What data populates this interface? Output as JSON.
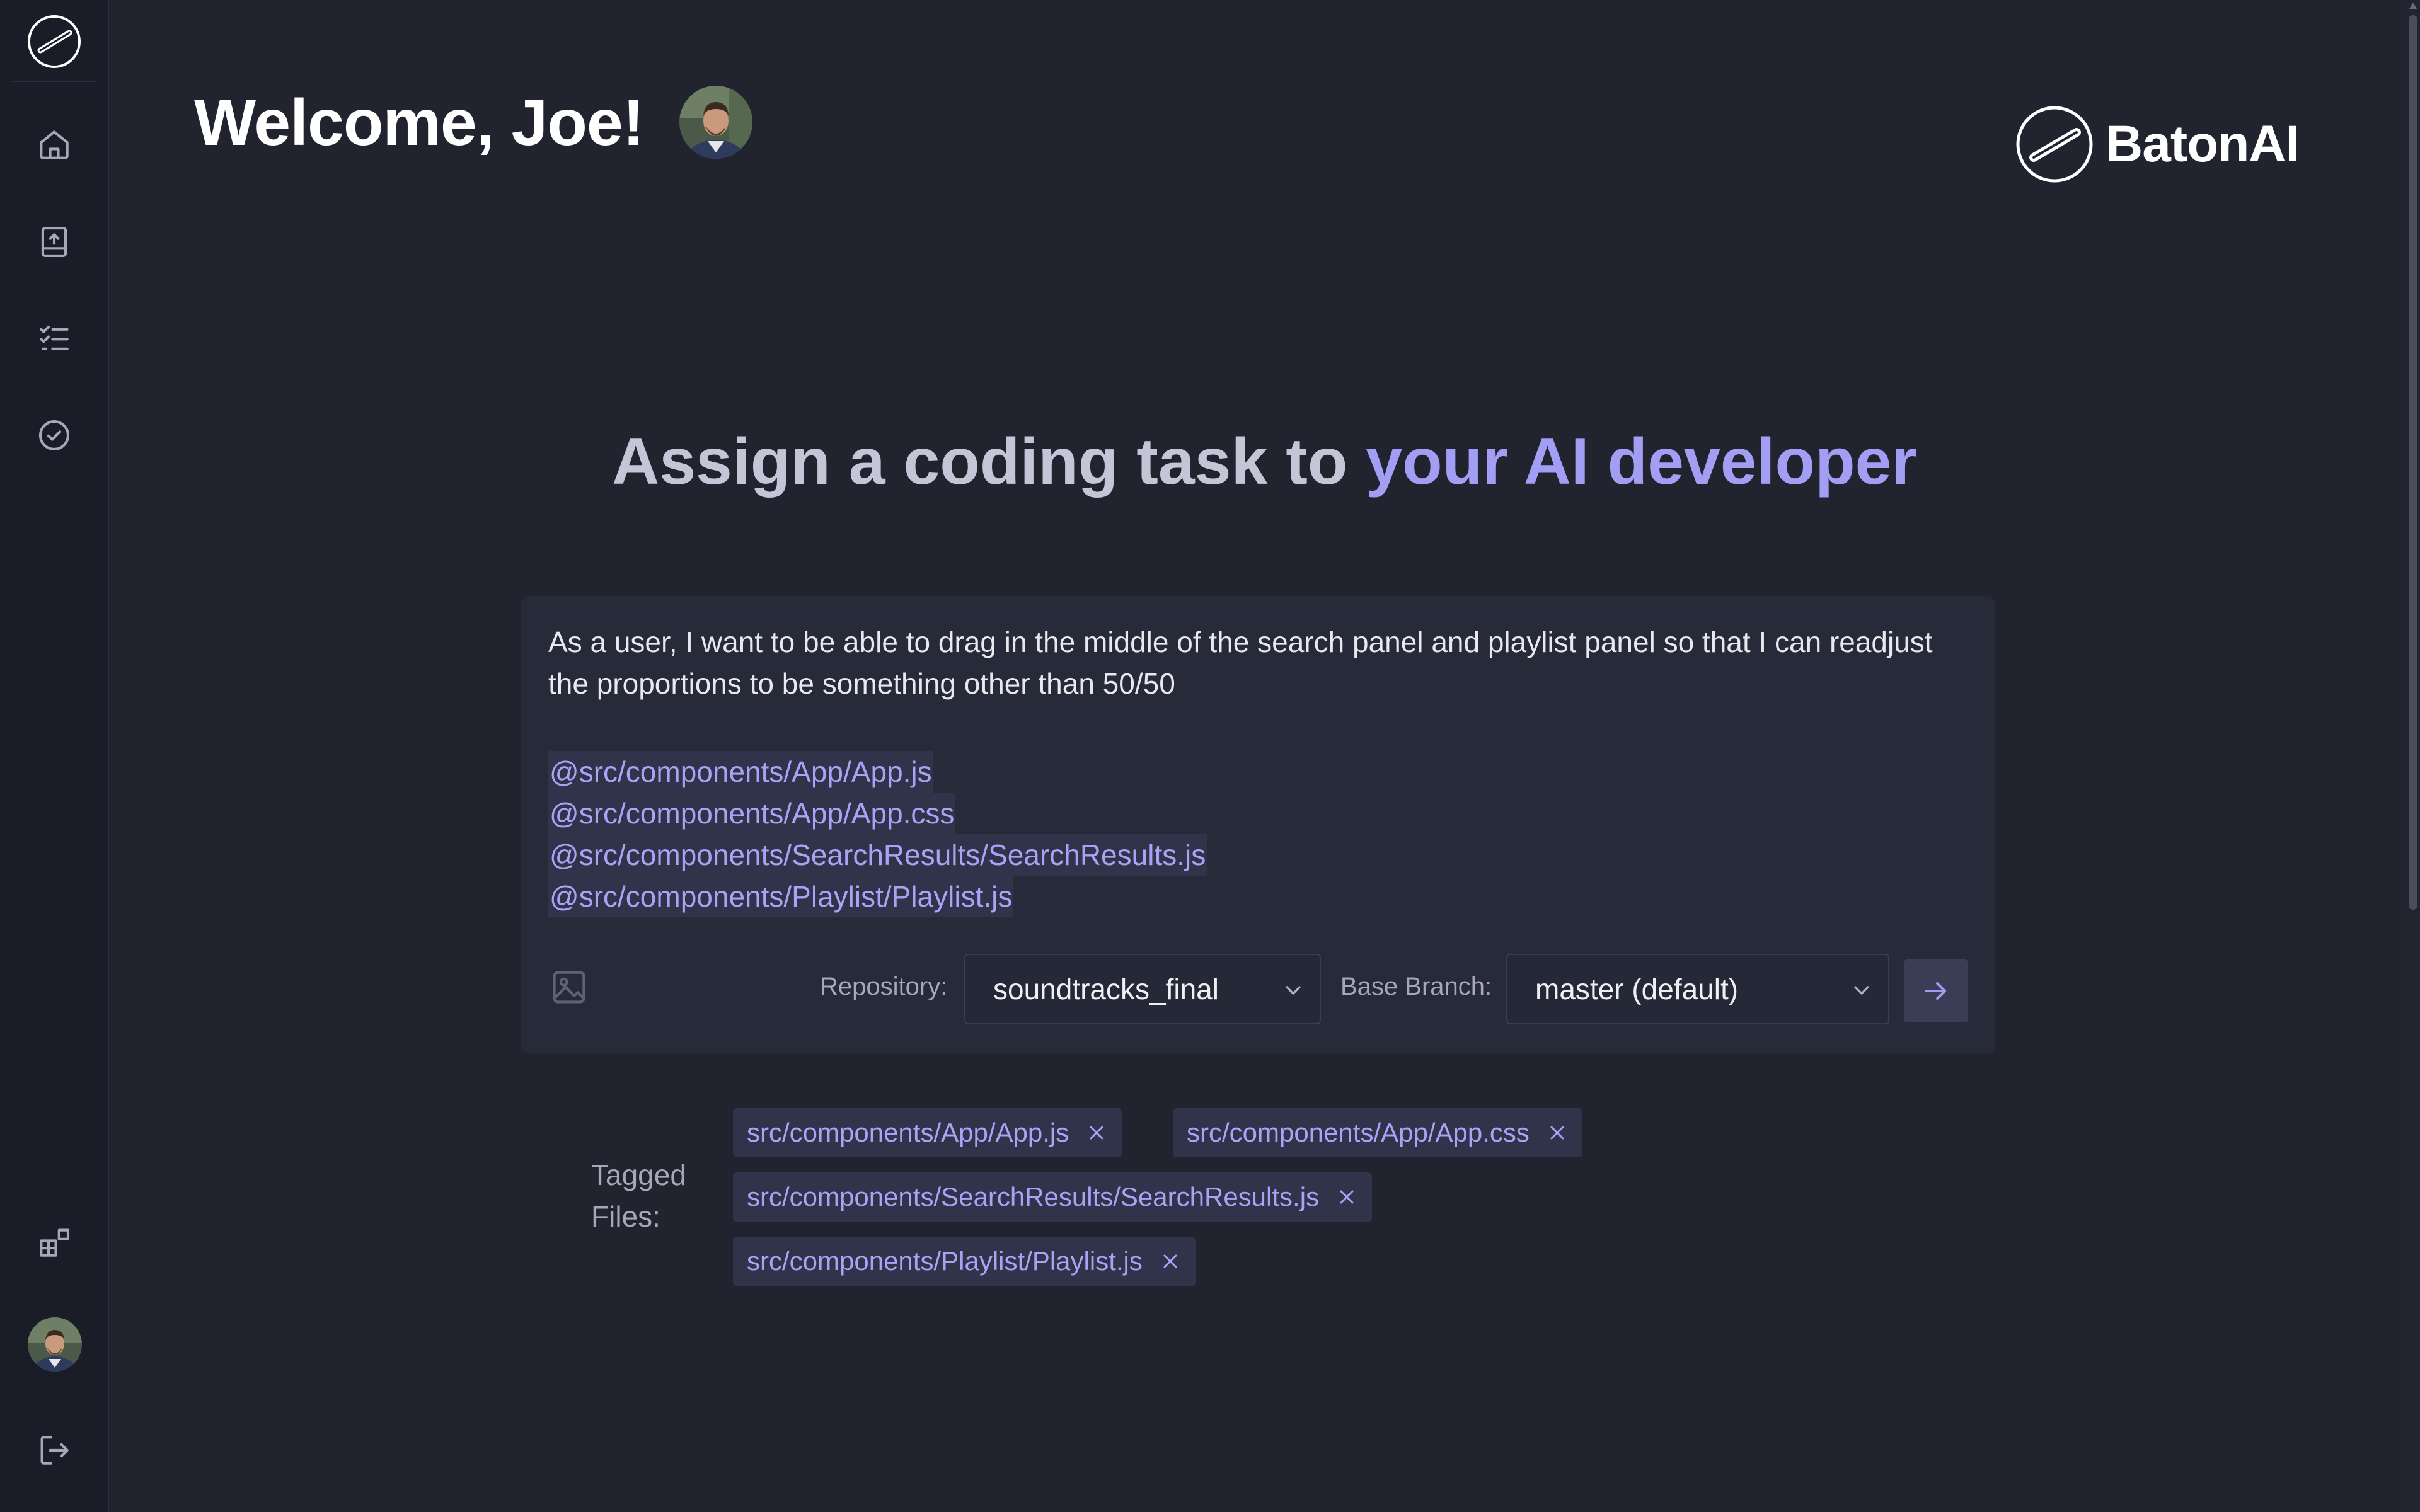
{
  "header": {
    "welcome": "Welcome, Joe!",
    "brand_name": "BatonAI"
  },
  "sidebar": {
    "items": [
      {
        "icon": "home-icon"
      },
      {
        "icon": "upload-icon"
      },
      {
        "icon": "task-list-icon"
      },
      {
        "icon": "check-circle-icon"
      },
      {
        "icon": "integrations-icon"
      },
      {
        "icon": "avatar"
      },
      {
        "icon": "logout-icon"
      }
    ]
  },
  "hero": {
    "title_part1": "Assign a coding task to ",
    "title_part2": "your AI developer"
  },
  "task": {
    "prompt": "As a user, I want to be able to drag in the middle of the search panel and playlist panel so that I can readjust the proportions to be something other than 50/50",
    "mentions": [
      "@src/components/App/App.js",
      "@src/components/App/App.css",
      "@src/components/SearchResults/SearchResults.js",
      "@src/components/Playlist/Playlist.js"
    ],
    "repository_label": "Repository:",
    "repository_value": "soundtracks_final",
    "branch_label": "Base Branch:",
    "branch_value": "master (default)"
  },
  "tagged": {
    "label": "Tagged Files:",
    "files": [
      "src/components/App/App.js",
      "src/components/App/App.css",
      "src/components/SearchResults/SearchResults.js",
      "src/components/Playlist/Playlist.js"
    ]
  },
  "colors": {
    "background": "#21232f",
    "sidebar": "#1a1c27",
    "card": "#272a38",
    "accent": "#a19ef4",
    "muted_text": "#a6a8b8"
  }
}
